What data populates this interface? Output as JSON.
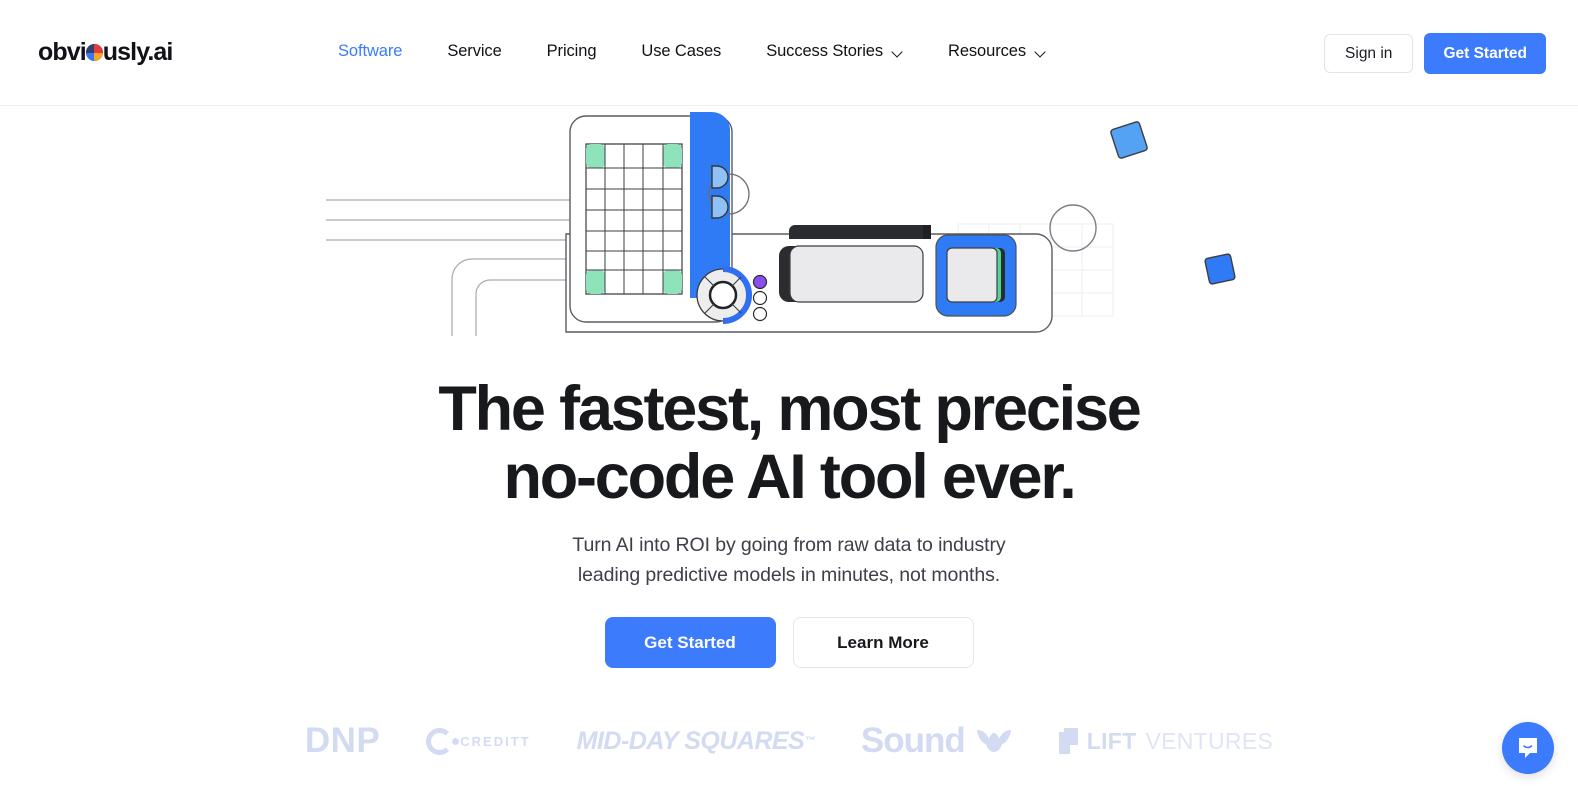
{
  "site": {
    "logo_text_before": "obvi",
    "logo_text_after": "usly.ai",
    "brand_blue": "#3b7bfc",
    "logo_mark_name": "pie-chart-logo-mark"
  },
  "nav": {
    "items": [
      {
        "label": "Software",
        "active": true,
        "has_dropdown": false
      },
      {
        "label": "Service",
        "active": false,
        "has_dropdown": false
      },
      {
        "label": "Pricing",
        "active": false,
        "has_dropdown": false
      },
      {
        "label": "Use Cases",
        "active": false,
        "has_dropdown": false
      },
      {
        "label": "Success Stories",
        "active": false,
        "has_dropdown": true
      },
      {
        "label": "Resources",
        "active": false,
        "has_dropdown": true
      }
    ]
  },
  "header_actions": {
    "sign_in_label": "Sign in",
    "get_started_label": "Get Started"
  },
  "hero": {
    "headline_line1": "The fastest, most precise",
    "headline_line2": "no-code AI tool ever.",
    "subtitle_line1": "Turn AI into ROI by going from raw data to industry",
    "subtitle_line2": "leading predictive models in minutes, not months.",
    "primary_cta": "Get Started",
    "secondary_cta": "Learn More"
  },
  "client_logos": [
    {
      "name": "DNP",
      "text": "DNP"
    },
    {
      "name": "CREDITT",
      "text": "CREDITT"
    },
    {
      "name": "MID-DAY SQUARES",
      "text": "MID-DAY SQUARES",
      "trademark": "™"
    },
    {
      "name": "Sound",
      "text": "Sound"
    },
    {
      "name": "LIFT VENTURES",
      "text_bold": "LIFT",
      "text_light": "VENTURES"
    }
  ],
  "chat": {
    "icon": "chat-bubble-smile-icon",
    "color": "#3b7bfc"
  }
}
